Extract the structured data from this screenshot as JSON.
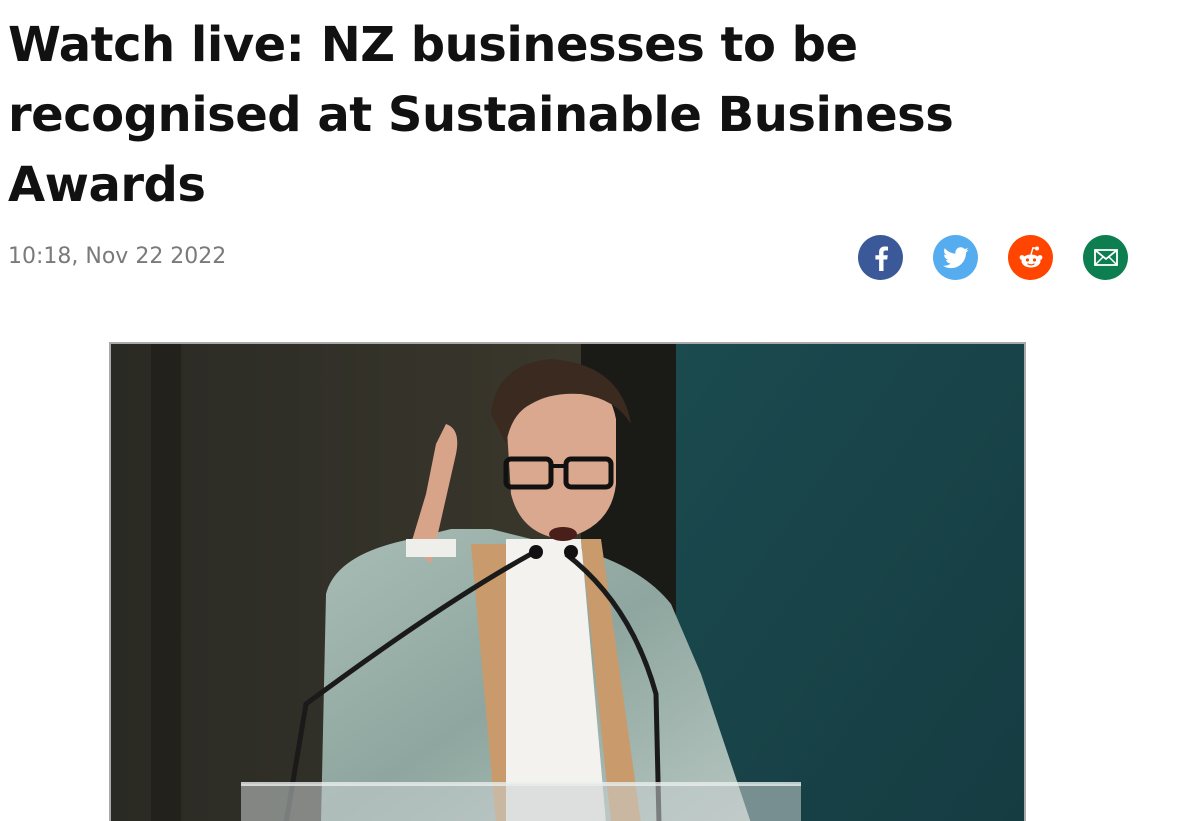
{
  "article": {
    "title": "Watch live: NZ businesses to be recognised at Sustainable Business Awards",
    "timestamp": "10:18, Nov 22 2022"
  },
  "share": [
    {
      "network": "facebook",
      "icon": "facebook-icon",
      "color": "#3b5998"
    },
    {
      "network": "twitter",
      "icon": "twitter-bird-icon",
      "color": "#55acee"
    },
    {
      "network": "reddit",
      "icon": "reddit-alien-icon",
      "color": "#ff4500"
    },
    {
      "network": "email",
      "icon": "envelope-icon",
      "color": "#0c7e4f"
    }
  ],
  "video": {
    "description_icon": "livestream-video-frame"
  }
}
